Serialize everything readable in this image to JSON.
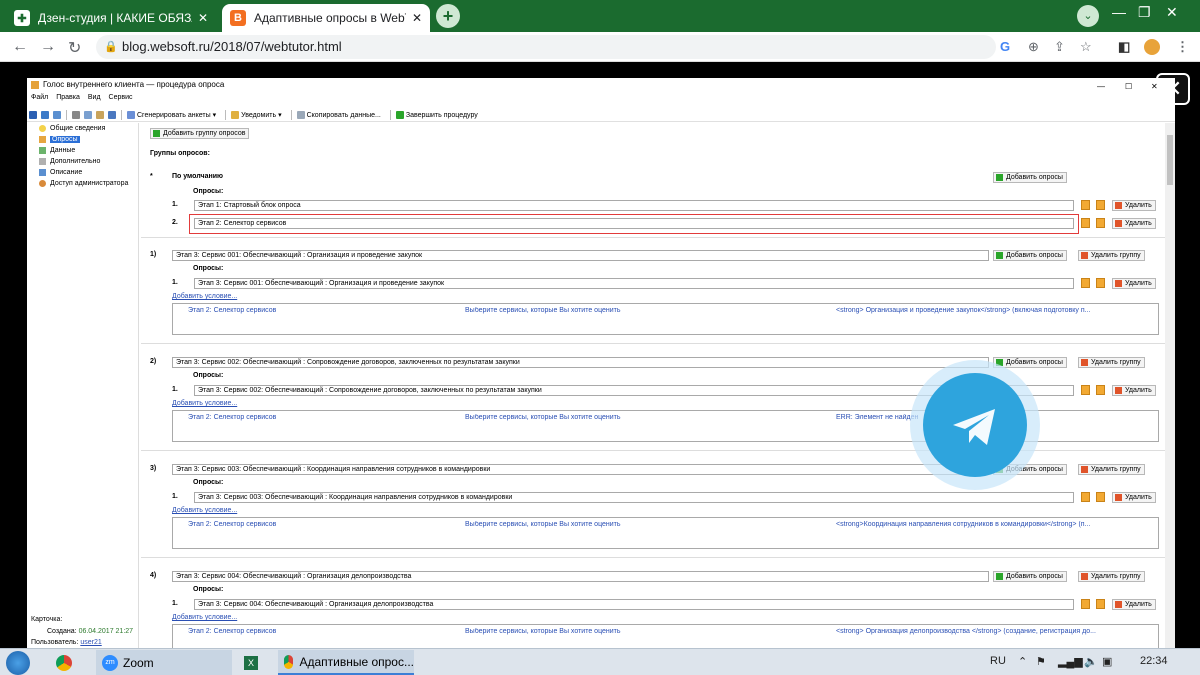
{
  "browser": {
    "tabs": [
      {
        "title": "Дзен-студия | КАКИЕ ОБЯЗАТЕЛ",
        "favicon_color": "#222222"
      },
      {
        "title": "Адаптивные опросы в WebTuto",
        "favicon_color": "#f36f21"
      }
    ],
    "new_tab": "+",
    "url": "blog.websoft.ru/2018/07/webtutor.html"
  },
  "app": {
    "title": "Голос внутреннего клиента — процедура опроса",
    "menu": [
      "Файл",
      "Правка",
      "Вид",
      "Сервис"
    ],
    "toolbar": {
      "generate": "Сгенерировать анкеты",
      "notify": "Уведомить",
      "copy": "Скопировать данные...",
      "finish": "Завершить процедуру"
    },
    "sidebar": {
      "items": [
        "Общие сведения",
        "Опросы",
        "Данные",
        "Дополнительно",
        "Описание",
        "Доступ администратора"
      ],
      "selected": 1,
      "card_label": "Карточка:",
      "created_label": "Создана:",
      "created_value": "06.04.2017 21:27",
      "user_label": "Пользователь:",
      "user_value": "user21"
    },
    "main": {
      "add_group": "Добавить группу опросов",
      "groups_label": "Группы опросов:",
      "default_label": "По умолчанию",
      "add_polls": "Добавить опросы",
      "polls_label": "Опросы:",
      "delete": "Удалить",
      "delete_group": "Удалить группу",
      "add_condition": "Добавить условие...",
      "default_polls": [
        {
          "num": "1.",
          "name": "Этап 1: Стартовый блок опроса"
        },
        {
          "num": "2.",
          "name": "Этап 2: Селектор сервисов"
        }
      ],
      "groups": [
        {
          "num": "1)",
          "name": "Этап 3: Сервис 001: Обеспечивающий : Организация и проведение закупок",
          "poll": "Этап 3: Сервис 001: Обеспечивающий : Организация и проведение закупок",
          "cond": [
            "Этап 2: Селектор сервисов",
            "Выберите сервисы, которые Вы хотите оценить",
            "<strong> Организация и проведение закупок</strong>  (включая подготовку п..."
          ]
        },
        {
          "num": "2)",
          "name": "Этап 3: Сервис 002: Обеспечивающий : Сопровождение договоров, заключенных по результатам закупки",
          "poll": "Этап 3: Сервис 002: Обеспечивающий : Сопровождение договоров, заключенных по результатам закупки",
          "cond": [
            "Этап 2: Селектор сервисов",
            "Выберите сервисы, которые Вы хотите оценить",
            "ERR: Элемент не найден"
          ]
        },
        {
          "num": "3)",
          "name": "Этап 3: Сервис 003: Обеспечивающий : Координация направления сотрудников в командировки",
          "poll": "Этап 3: Сервис 003: Обеспечивающий : Координация направления сотрудников в командировки",
          "cond": [
            "Этап 2: Селектор сервисов",
            "Выберите сервисы, которые Вы хотите оценить",
            "<strong>Координация направления сотрудников в командировки</strong>  (п..."
          ]
        },
        {
          "num": "4)",
          "name": "Этап 3: Сервис 004: Обеспечивающий : Организация делопроизводства",
          "poll": "Этап 3: Сервис 004: Обеспечивающий : Организация делопроизводства",
          "cond": [
            "Этап 2: Селектор сервисов",
            "Выберите сервисы, которые Вы хотите оценить",
            "<strong> Организация делопроизводства </strong>  (создание, регистрация до..."
          ]
        }
      ]
    }
  },
  "taskbar": {
    "zoom": "Zoom",
    "chrome_window": "Адаптивные опрос...",
    "lang": "RU",
    "time": "22:34"
  }
}
